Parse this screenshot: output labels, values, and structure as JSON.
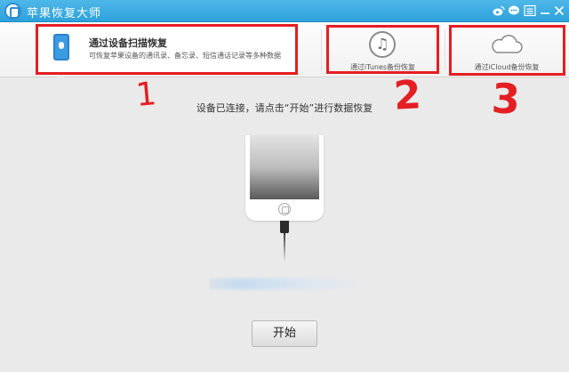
{
  "window": {
    "title": "苹果恢复大师",
    "controls": [
      "weibo-icon",
      "chat-icon",
      "menu-icon",
      "minimize-icon",
      "close-icon"
    ]
  },
  "modes": [
    {
      "title": "通过设备扫描恢复",
      "description": "可恢复苹果设备的通讯录、备忘录、短信通话记录等多种数据",
      "icon": "phone-icon",
      "selected": true
    },
    {
      "label": "通过iTunes备份恢复",
      "icon": "music-note-icon",
      "selected": false
    },
    {
      "label": "通过iCloud备份恢复",
      "icon": "cloud-icon",
      "selected": false
    }
  ],
  "annotations": [
    "1",
    "2",
    "3"
  ],
  "main": {
    "status": "设备已连接，请点击“开始”进行数据恢复",
    "start_label": "开始"
  },
  "colors": {
    "titlebar": "#3ba9e0",
    "annotation": "#e41e22",
    "accent": "#3b9be3"
  }
}
